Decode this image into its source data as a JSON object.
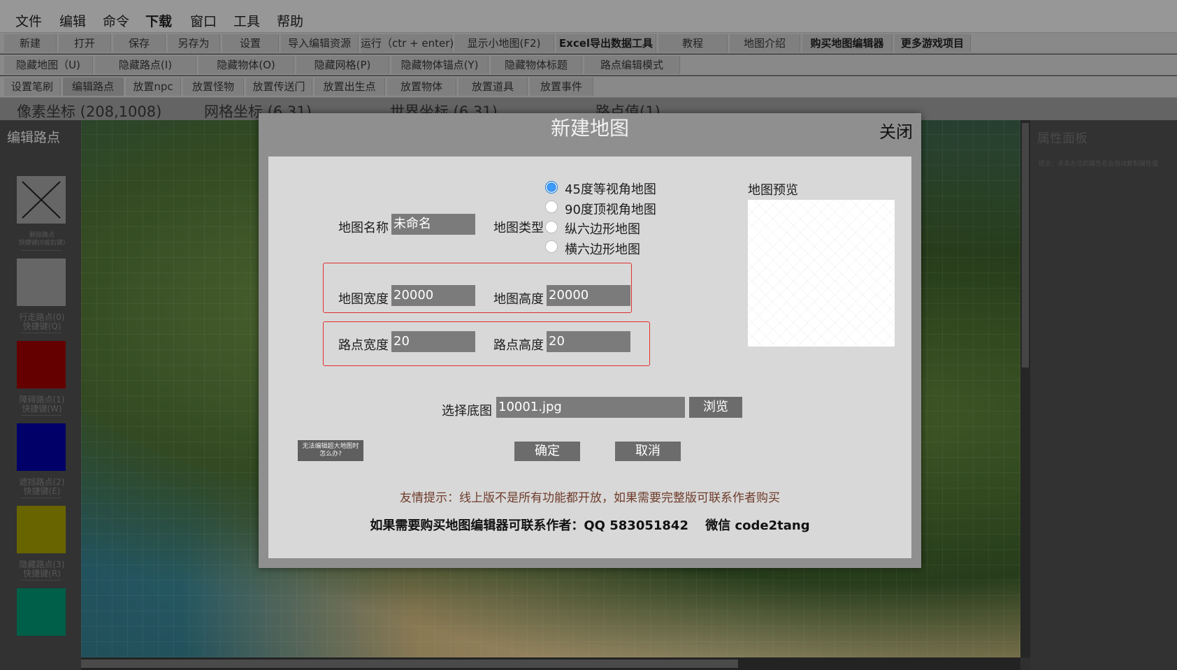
{
  "menu": [
    "文件",
    "编辑",
    "命令",
    "下载",
    "窗口",
    "工具",
    "帮助"
  ],
  "toolbar_row1": [
    "新建",
    "打开",
    "保存",
    "另存为",
    "设置",
    "导入编辑资源",
    "运行（ctr + enter)",
    "显示小地图(F2)",
    "Excel导出数据工具",
    "教程",
    "地图介绍",
    "购买地图编辑器",
    "更多游戏项目"
  ],
  "toolbar_row2": [
    "隐藏地图（U)",
    "隐藏路点(I)",
    "隐藏物体(O)",
    "隐藏网格(P)",
    "隐藏物体锚点(Y)",
    "隐藏物体标题",
    "路点编辑模式"
  ],
  "toolbar_row3": [
    "设置笔刷",
    "编辑路点",
    "放置npc",
    "放置怪物",
    "放置传送门",
    "放置出生点",
    "放置物体",
    "放置道具",
    "放置事件"
  ],
  "coords": {
    "pixel": "像素坐标 (208,1008)",
    "grid": "网格坐标 (6,31)",
    "world": "世界坐标 (6,31)",
    "node": "路点值(1)"
  },
  "left_panel": {
    "title": "编辑路点",
    "items": [
      {
        "label1": "删除路点",
        "label2": "快捷键(0或右键)",
        "color": "#7d7d7d"
      },
      {
        "label1": "行走路点(0)",
        "label2": "快捷键(Q)",
        "color": "#7d7d7d"
      },
      {
        "label1": "障碍路点(1)",
        "label2": "快捷键(W)",
        "color": "#7a0000"
      },
      {
        "label1": "遮挡路点(2)",
        "label2": "快捷键(E)",
        "color": "#00007f"
      },
      {
        "label1": "隐藏路点(3)",
        "label2": "快捷键(R)",
        "color": "#7f7a00"
      },
      {
        "color": "#00745a"
      }
    ]
  },
  "right_panel": {
    "title": "属性面板",
    "hint": "提示：点击左边的属性名会自动复制属性值"
  },
  "dialog": {
    "title": "新建地图",
    "close": "关闭",
    "map_name_label": "地图名称",
    "map_name_value": "未命名",
    "map_type_label": "地图类型",
    "map_types": [
      "45度等视角地图",
      "90度顶视角地图",
      "纵六边形地图",
      "横六边形地图"
    ],
    "map_type_selected": 0,
    "preview_label": "地图预览",
    "map_width_label": "地图宽度",
    "map_width_value": "20000",
    "map_height_label": "地图高度",
    "map_height_value": "20000",
    "node_width_label": "路点宽度",
    "node_width_value": "20",
    "node_height_label": "路点高度",
    "node_height_value": "20",
    "bg_label": "选择底图",
    "bg_value": "10001.jpg",
    "browse": "浏览",
    "help_line1": "无法编辑超大地图时",
    "help_line2": "怎么办?",
    "ok": "确定",
    "cancel": "取消",
    "note1": "友情提示：线上版不是所有功能都开放，如果需要完整版可联系作者购买",
    "note2": "如果需要购买地图编辑器可联系作者：QQ 583051842　 微信 code2tang"
  }
}
